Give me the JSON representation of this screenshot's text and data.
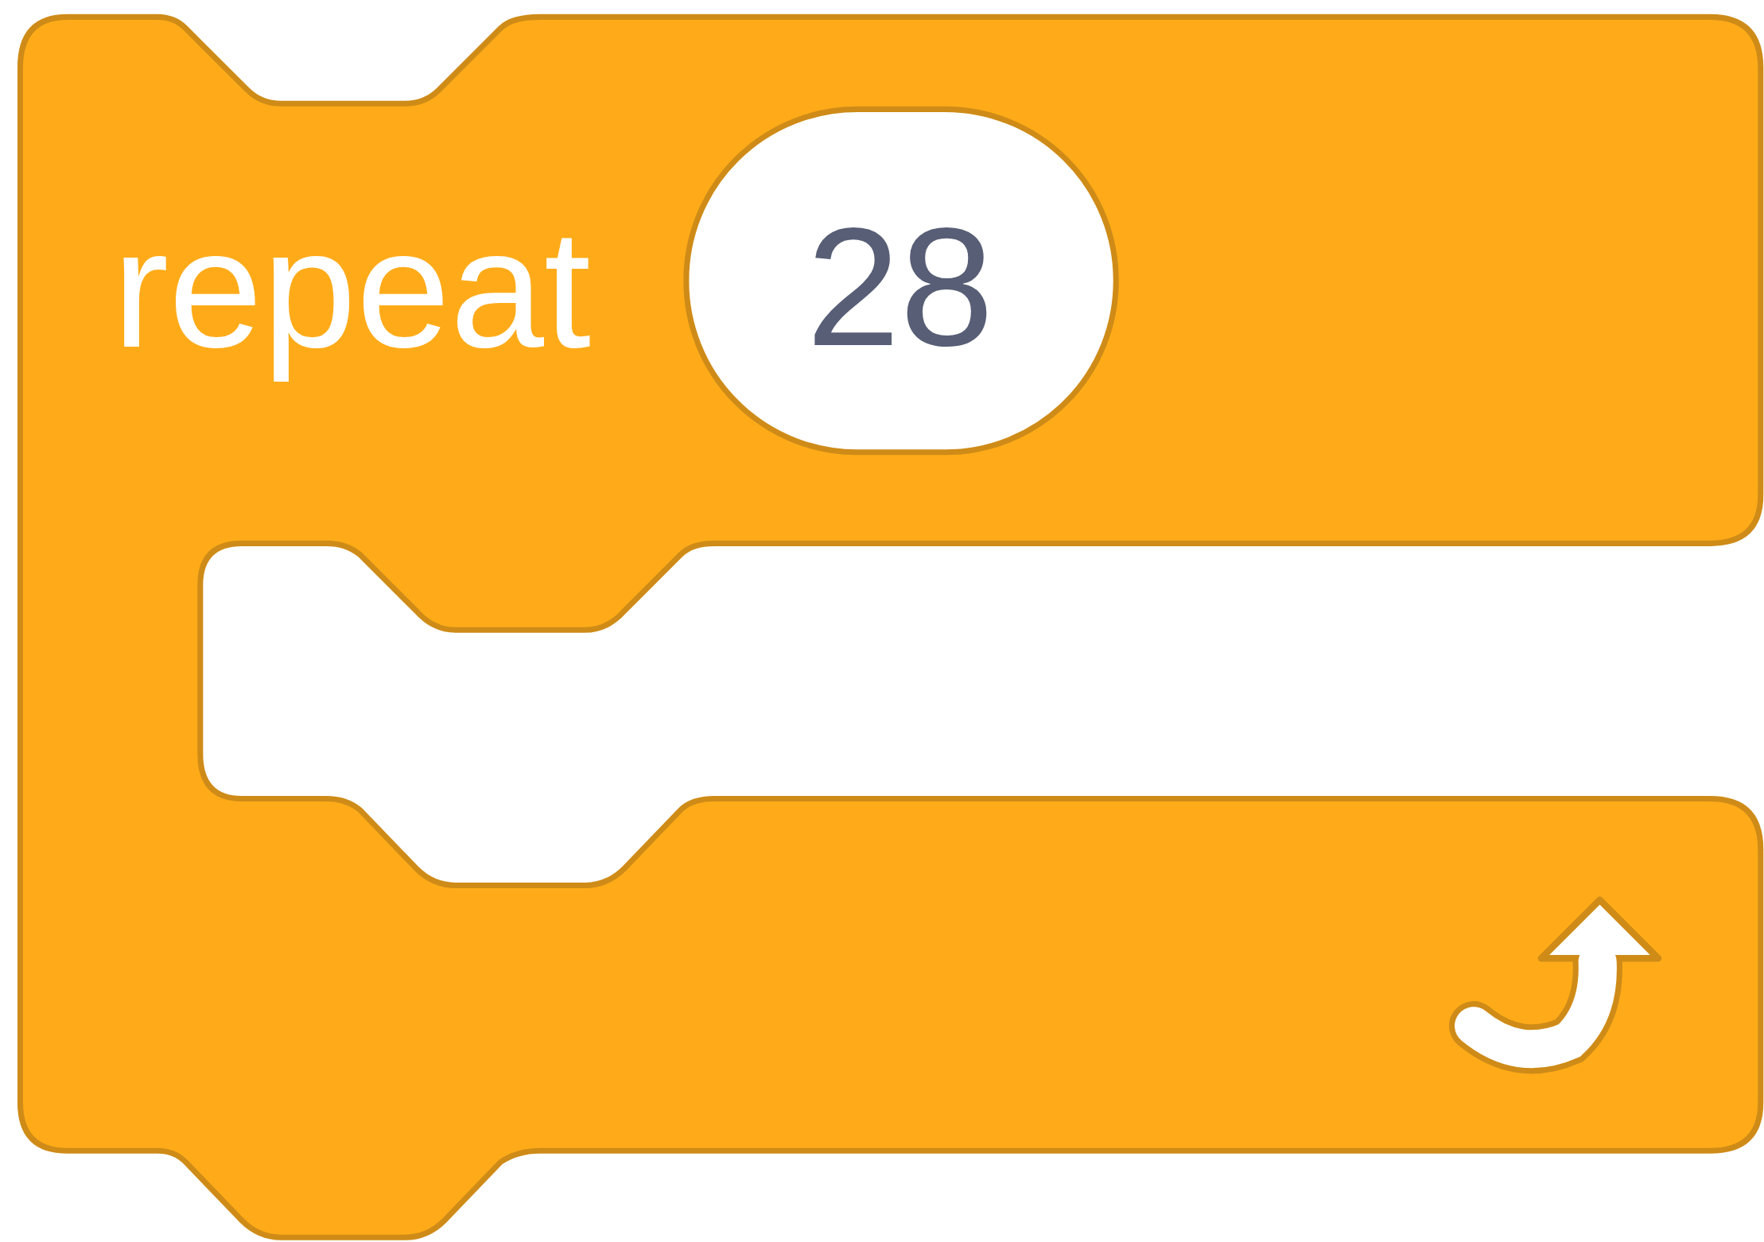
{
  "block": {
    "label": "repeat",
    "count": "28"
  }
}
